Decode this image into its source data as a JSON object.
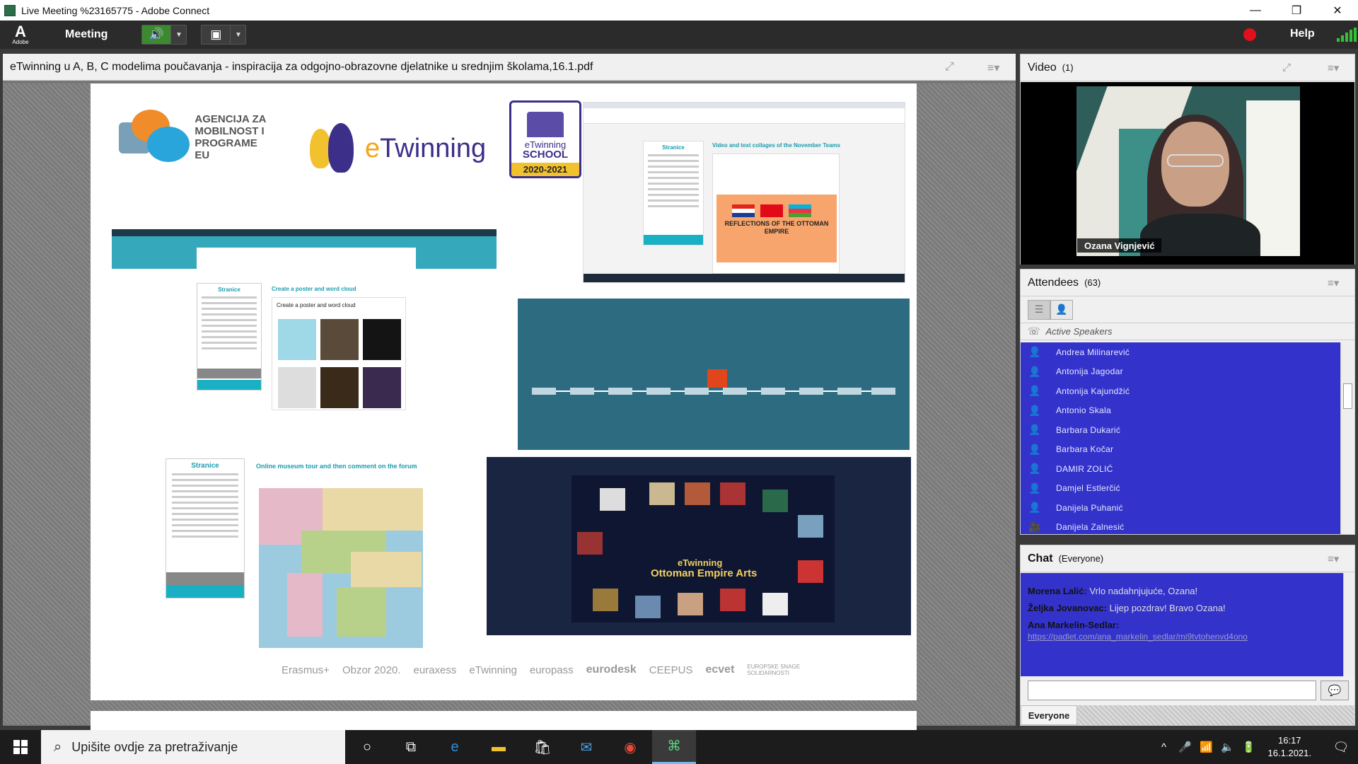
{
  "window": {
    "title": "Live Meeting %23165775 - Adobe Connect",
    "minimize": "—",
    "restore": "❐",
    "close": "✕"
  },
  "menubar": {
    "logo_letter": "A",
    "logo_text": "Adobe",
    "meeting_label": "Meeting",
    "help_label": "Help",
    "speaker_icon": "speaker-icon",
    "webcam_icon": "webcam-icon",
    "record_color": "#e0101c",
    "signal_color": "#36c235"
  },
  "share": {
    "filename": "eTwinning u A, B, C modelima poučavanja - inspiracija za odgojno-obrazovne djelatnike u srednjim školama,16.1.pdf"
  },
  "slide": {
    "agency_lines": [
      "AGENCIJA ZA",
      "MOBILNOST I",
      "PROGRAME EU"
    ],
    "etwinning_e": "e",
    "etwinning_rest": "Twinning",
    "school": {
      "brand": "eTwinning",
      "word": "SCHOOL",
      "years": "2020-2021"
    },
    "tr_sidebar": "Stranice",
    "tr_caption": "Video and text collages of the November Teams",
    "tr_poster_title": "REFLECTIONS OF THE OTTOMAN EMPIRE",
    "ml_sidebar": "Stranice",
    "ml_caption": "Create a poster and word cloud",
    "ml_frame_title": "Create a poster and word cloud",
    "bl_sidebar": "Stranice",
    "bl_caption": "Online museum tour and then comment on the forum",
    "br_title1": "eTwinning",
    "br_title2": "Ottoman Empire Arts",
    "partners": [
      "Erasmus+",
      "Obzor 2020.",
      "euraxess",
      "eTwinning",
      "europass",
      "eurodesk",
      "CEEPUS",
      "ecvet",
      "EUROPSKE SNAGE SOLIDARNOSTI"
    ]
  },
  "video": {
    "title": "Video",
    "count": "(1)",
    "speaker_name": "Ozana Vignjević"
  },
  "attendees": {
    "title": "Attendees",
    "count": "(63)",
    "active_speakers": "Active Speakers",
    "list": [
      "Andrea Milinarević",
      "Antonija Jagodar",
      "Antonija Kajundžić",
      "Antonio Skala",
      "Barbara Dukarić",
      "Barbara Kočar",
      "DAMIR ZOLIĆ",
      "Damjel Estlerčić",
      "Danijela Puhanić",
      "Danijela Zalnesić"
    ]
  },
  "chat": {
    "title": "Chat",
    "audience": "(Everyone)",
    "messages": [
      {
        "author": "Morena Lalić:",
        "text": "Vrlo nadahnjujuće, Ozana!",
        "link": ""
      },
      {
        "author": "Željka Jovanovac:",
        "text": "Lijep pozdrav! Bravo Ozana!",
        "link": ""
      },
      {
        "author": "Ana Markelin-Sedlar:",
        "text": "",
        "link": "https://padlet.com/ana_markelin_sedlar/mi9tvtohenvd4ono"
      }
    ],
    "tab_label": "Everyone",
    "send_icon": "speech-bubble-icon"
  },
  "taskbar": {
    "search_placeholder": "Upišite ovdje za pretraživanje",
    "time": "16:17",
    "date": "16.1.2021."
  }
}
